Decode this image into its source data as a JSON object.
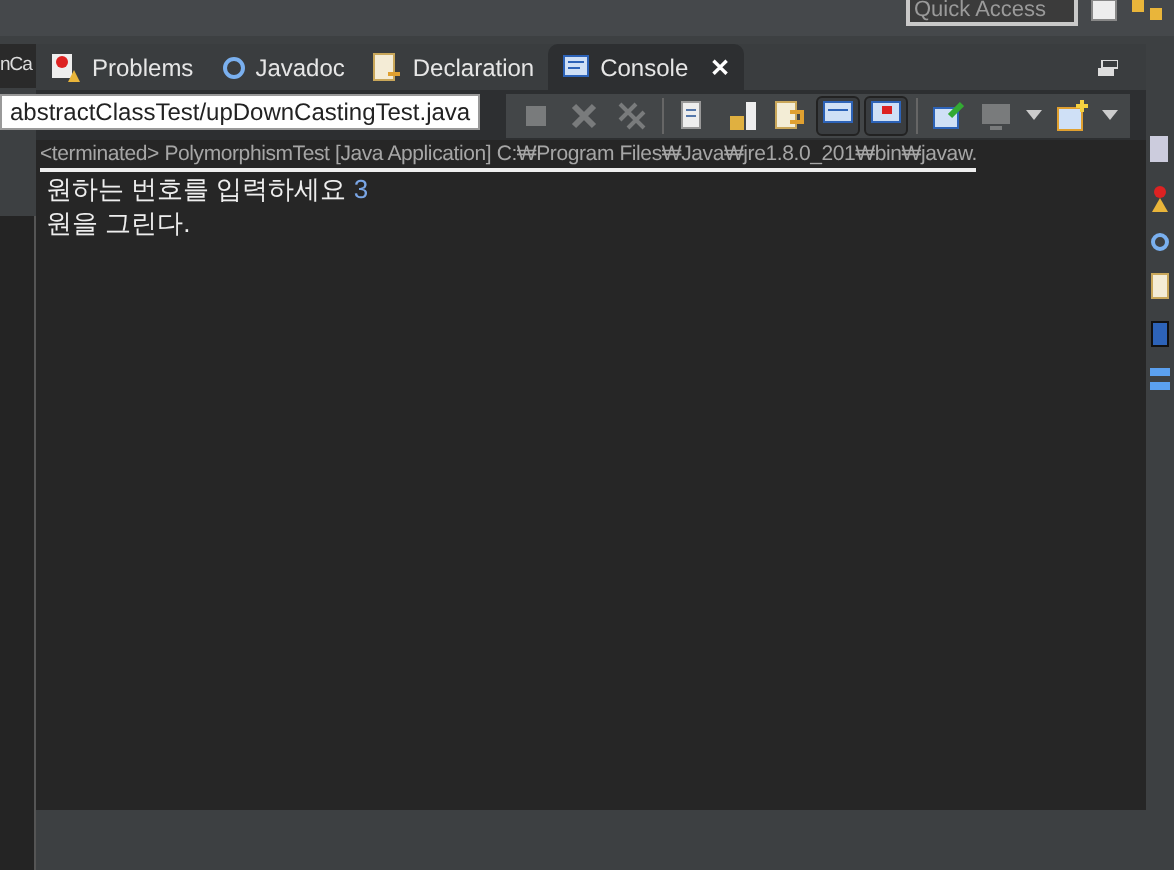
{
  "top_bar": {
    "quick_access": {
      "placeholder": "Quick Access"
    }
  },
  "editor_tab": {
    "label": "nCa"
  },
  "tabs": [
    {
      "label": "Problems",
      "kind": "problems",
      "selected": false
    },
    {
      "label": "Javadoc",
      "kind": "javadoc",
      "selected": false
    },
    {
      "label": "Declaration",
      "kind": "declaration",
      "selected": false
    },
    {
      "label": "Console",
      "kind": "console",
      "selected": true,
      "close": "✕"
    }
  ],
  "tooltip": "abstractClassTest/upDownCastingTest.java",
  "toolbar": [
    {
      "kind": "stop",
      "disabled": true
    },
    {
      "kind": "remove",
      "disabled": true
    },
    {
      "kind": "remove-all",
      "disabled": true
    },
    {
      "kind": "clear",
      "disabled": false
    },
    {
      "kind": "scroll-lock",
      "disabled": false
    },
    {
      "kind": "word-wrap",
      "disabled": false
    },
    {
      "kind": "show-out",
      "disabled": false,
      "selected": true
    },
    {
      "kind": "show-err",
      "disabled": false,
      "selected": true
    },
    {
      "kind": "pin",
      "disabled": false
    },
    {
      "kind": "display",
      "disabled": true,
      "dropdown": true
    },
    {
      "kind": "open-console",
      "disabled": false,
      "dropdown": true
    }
  ],
  "console": {
    "header": "<terminated> PolymorphismTest [Java Application] C:₩Program Files₩Java₩jre1.8.0_201₩bin₩javaw.",
    "lines": [
      {
        "output": "원하는 번호를 입력하세요 ",
        "input": "3"
      },
      {
        "output": "원을 그린다."
      }
    ]
  }
}
